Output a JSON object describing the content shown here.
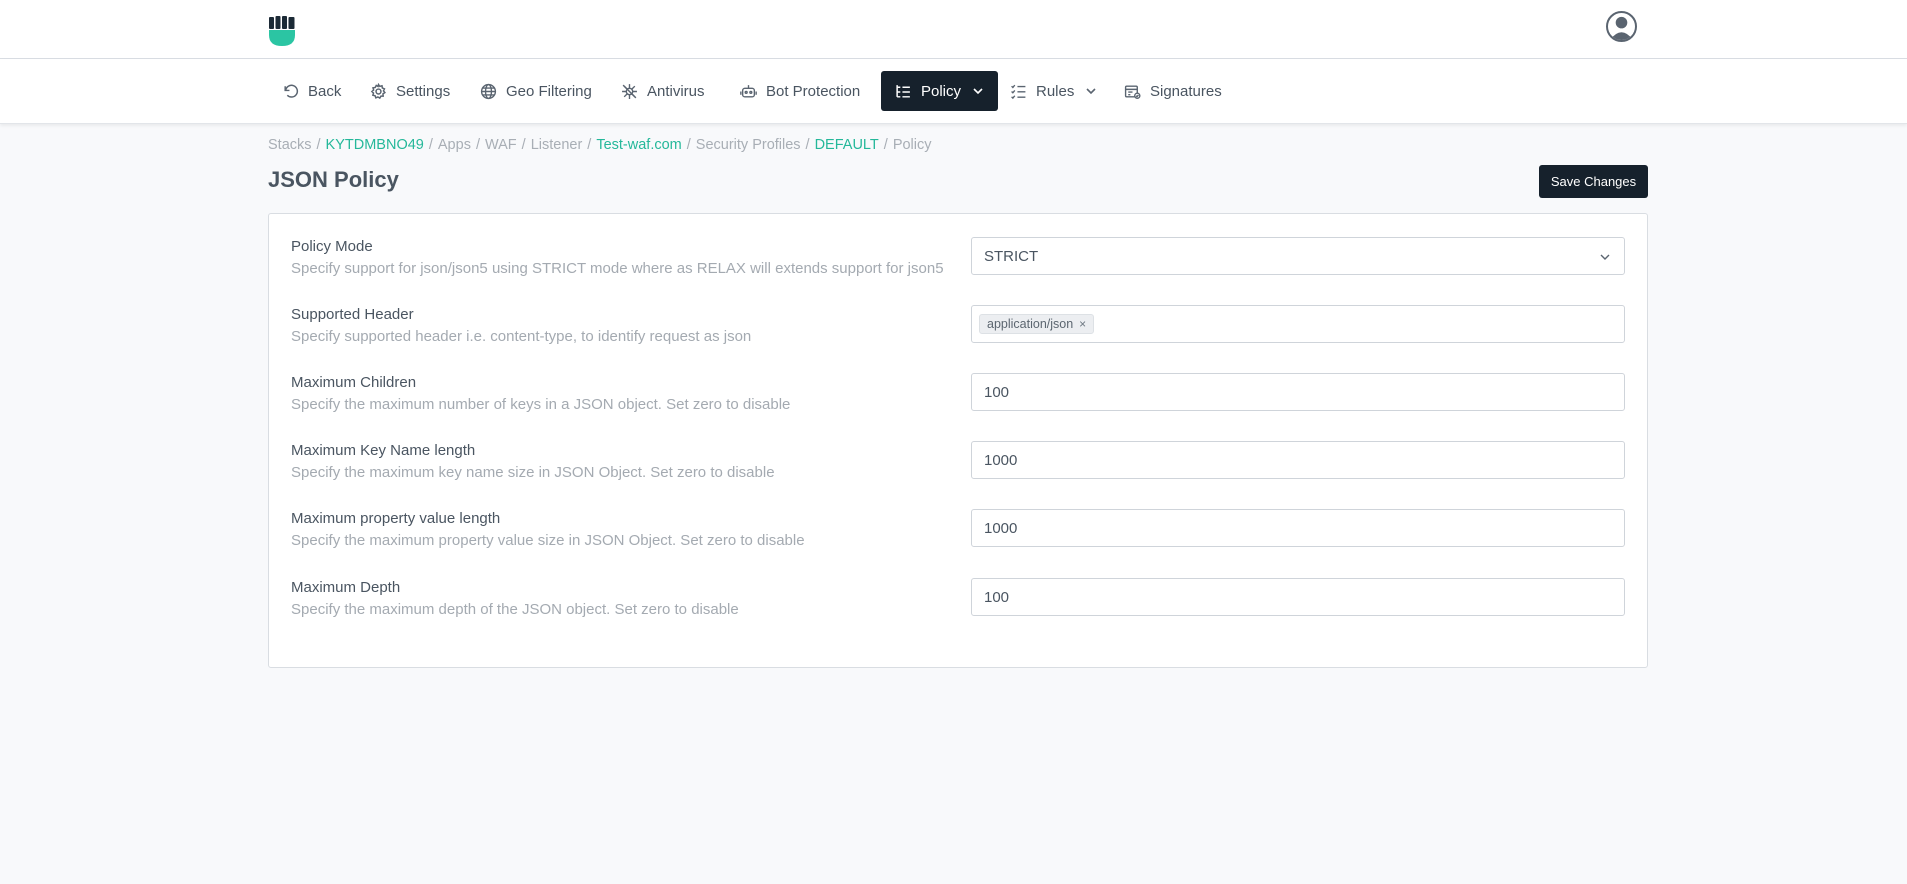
{
  "nav": {
    "items": [
      {
        "label": "Back",
        "icon": "undo-icon"
      },
      {
        "label": "Settings",
        "icon": "gear-icon"
      },
      {
        "label": "Geo Filtering",
        "icon": "globe-icon"
      },
      {
        "label": "Antivirus",
        "icon": "virus-icon"
      },
      {
        "label": "Bot Protection",
        "icon": "robot-icon"
      },
      {
        "label": "Policy",
        "icon": "list-tree-icon",
        "active": true
      },
      {
        "label": "Rules",
        "icon": "checklist-icon"
      },
      {
        "label": "Signatures",
        "icon": "signature-icon"
      }
    ]
  },
  "breadcrumb": {
    "items": [
      "Stacks",
      "KYTDMBNO49",
      "Apps",
      "WAF",
      "Listener",
      "Test-waf.com",
      "Security Profiles",
      "DEFAULT",
      "Policy"
    ],
    "separator": "/"
  },
  "page": {
    "title": "JSON Policy",
    "save_label": "Save Changes"
  },
  "form": {
    "policy_mode": {
      "label": "Policy Mode",
      "description": "Specify support for json/json5 using STRICT mode where as RELAX will extends support for json5",
      "value": "STRICT"
    },
    "supported_header": {
      "label": "Supported Header",
      "description": "Specify supported header i.e. content-type, to identify request as json",
      "tag": "application/json",
      "tag_remove": "×"
    },
    "max_children": {
      "label": "Maximum Children",
      "description": "Specify the maximum number of keys in a JSON object. Set zero to disable",
      "value": "100"
    },
    "max_key_name_length": {
      "label": "Maximum Key Name length",
      "description": "Specify the maximum key name size in JSON Object. Set zero to disable",
      "value": "1000"
    },
    "max_property_value_length": {
      "label": "Maximum property value length",
      "description": "Specify the maximum property value size in JSON Object. Set zero to disable",
      "value": "1000"
    },
    "max_depth": {
      "label": "Maximum Depth",
      "description": "Specify the maximum depth of the JSON object. Set zero to disable",
      "value": "100"
    }
  },
  "colors": {
    "accent": "#25b89a",
    "dark": "#16212c",
    "background": "#f8f9fb"
  }
}
